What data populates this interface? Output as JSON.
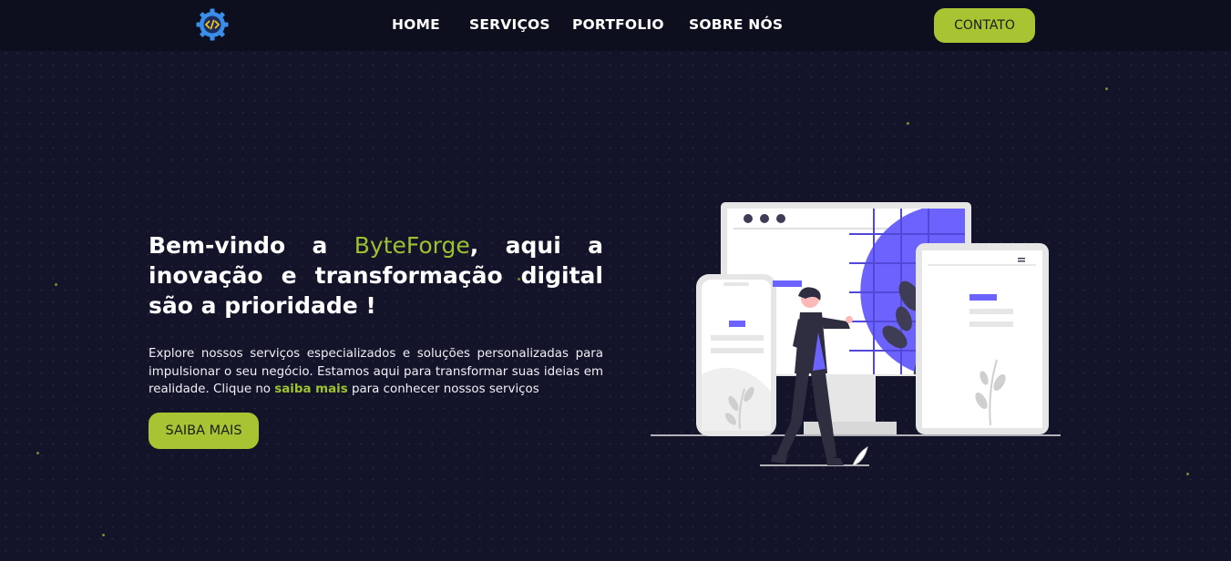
{
  "header": {
    "logo_icon": "gear-code-icon",
    "nav": [
      {
        "label": "HOME"
      },
      {
        "label": "SERVIÇOS"
      },
      {
        "label": "PORTFOLIO"
      },
      {
        "label": "SOBRE NÓS"
      }
    ],
    "contact_label": "CONTATO"
  },
  "hero": {
    "title_part1": "Bem-vindo a ",
    "title_brand": "ByteForge",
    "title_part2": ", aqui a inovação e transformação digital são a prioridade !",
    "text_part1": "Explore nossos serviços especializados e soluções personalizadas para impulsionar o seu negócio. Estamos aqui para transformar suas ideias em realidade. Clique no ",
    "text_link": "saiba mais",
    "text_part2": " para conhecer nossos serviços",
    "cta_label": "SAIBA MAIS",
    "illustration_icon": "responsive-devices-illustration"
  },
  "colors": {
    "background": "#13142a",
    "header": "#0e0f1e",
    "accent": "#a7c532",
    "illustration_purple": "#6c63ff"
  }
}
